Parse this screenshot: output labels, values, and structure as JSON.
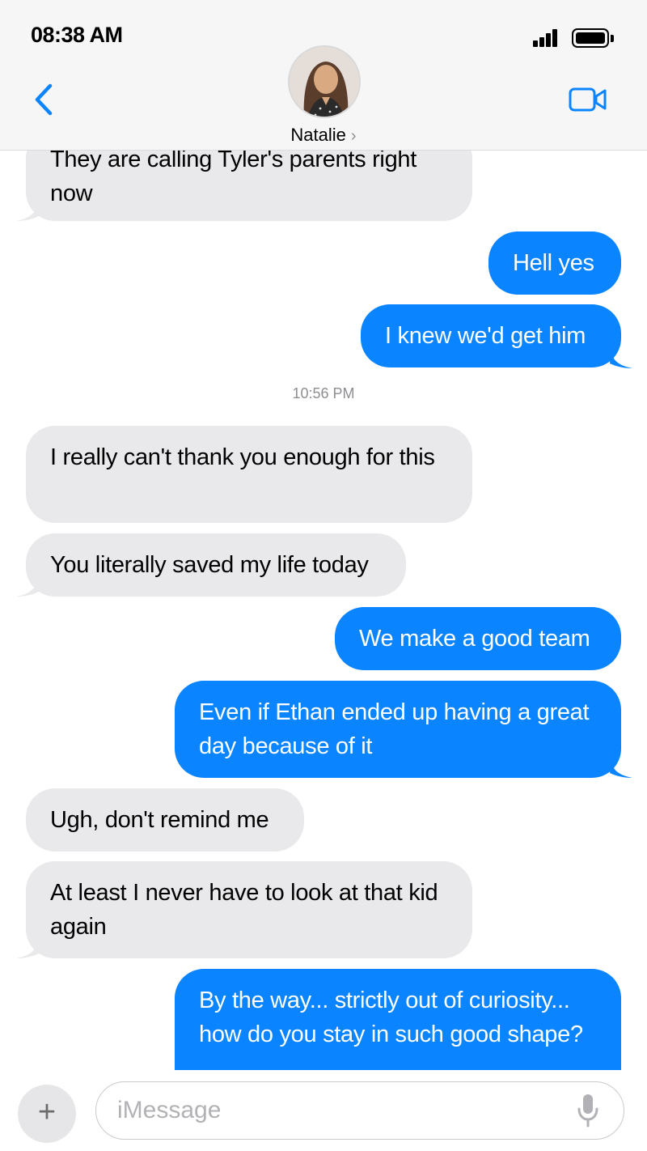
{
  "status_bar": {
    "time": "08:38 AM"
  },
  "header": {
    "contact_name": "Natalie",
    "chevron": "›",
    "back_icon": "chevron-left-icon",
    "video_icon": "video-camera-icon",
    "accent_color": "#0a84ff"
  },
  "messages": [
    {
      "from": "them",
      "text": "They are calling Tyler's parents right now"
    },
    {
      "from": "me",
      "text": "Hell yes"
    },
    {
      "from": "me",
      "text": "I knew we'd get him"
    },
    {
      "from": "them",
      "text": "I really can't thank you enough for this"
    },
    {
      "from": "them",
      "text": "You literally saved my life today"
    },
    {
      "from": "me",
      "text": "We make a good team"
    },
    {
      "from": "me",
      "text": "Even if Ethan ended up having a great day because of it"
    },
    {
      "from": "them",
      "text": "Ugh, don't remind me"
    },
    {
      "from": "them",
      "text": "At least I never have to look at that kid again"
    },
    {
      "from": "me",
      "text": "By the way... strictly out of curiosity... how do you stay in such good shape?"
    }
  ],
  "timestamp": "10:56 PM",
  "input_bar": {
    "placeholder": "iMessage",
    "value": "",
    "plus_icon": "plus-icon",
    "mic_icon": "microphone-icon"
  },
  "colors": {
    "outgoing_bubble": "#0a84ff",
    "incoming_bubble": "#e9e9eb",
    "header_bg": "#f6f6f6"
  }
}
